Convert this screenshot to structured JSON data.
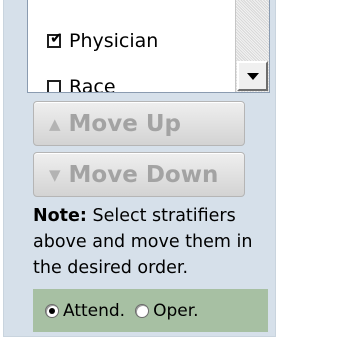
{
  "stratifier_list": {
    "items": [
      {
        "label": "Physician",
        "checked": true
      },
      {
        "label": "Race",
        "checked": false
      }
    ]
  },
  "buttons": {
    "move_up": "Move Up",
    "move_down": "Move Down"
  },
  "note": {
    "bold": "Note:",
    "text": " Select stratifiers above and move them in the desired order."
  },
  "physician_type": {
    "options": [
      {
        "label": "Attend.",
        "selected": true
      },
      {
        "label": "Oper.",
        "selected": false
      }
    ]
  }
}
